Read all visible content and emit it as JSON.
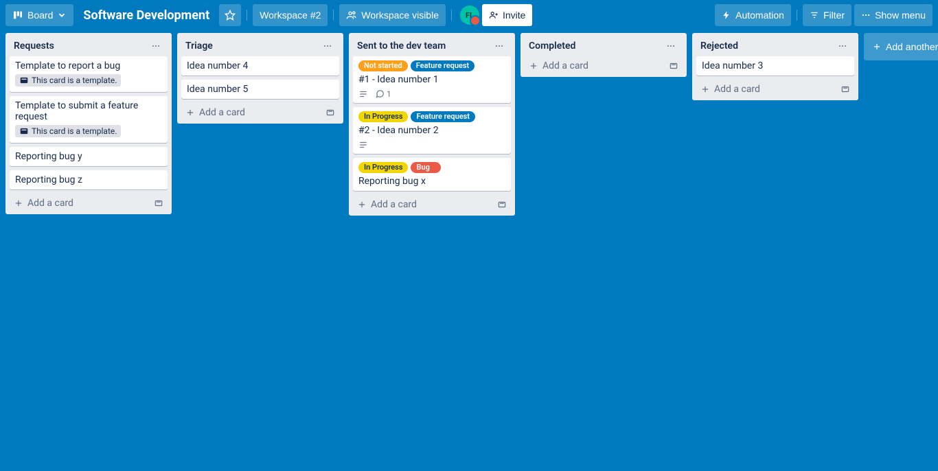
{
  "header": {
    "view_label": "Board",
    "board_title": "Software Development",
    "workspace_label": "Workspace #2",
    "visibility_label": "Workspace visible",
    "avatar_initials": "FL",
    "invite_label": "Invite",
    "automation_label": "Automation",
    "filter_label": "Filter",
    "show_menu_label": "Show menu"
  },
  "strings": {
    "add_card": "Add a card",
    "template_card": "This card is a template.",
    "add_another_list": "Add another list"
  },
  "lists": [
    {
      "title": "Requests",
      "cards": [
        {
          "title": "Template to report a bug",
          "is_template": true
        },
        {
          "title": "Template to submit a feature request",
          "is_template": true
        },
        {
          "title": "Reporting bug y"
        },
        {
          "title": "Reporting bug z"
        }
      ]
    },
    {
      "title": "Triage",
      "cards": [
        {
          "title": "Idea number 4"
        },
        {
          "title": "Idea number 5"
        }
      ]
    },
    {
      "title": "Sent to the dev team",
      "cards": [
        {
          "title": "#1 - Idea number 1",
          "labels": [
            {
              "text": "Not started",
              "color": "orange"
            },
            {
              "text": "Feature request",
              "color": "blue"
            }
          ],
          "has_description": true,
          "comments": 1
        },
        {
          "title": "#2 - Idea number 2",
          "labels": [
            {
              "text": "In Progress",
              "color": "yellow"
            },
            {
              "text": "Feature request",
              "color": "blue"
            }
          ],
          "has_description": true
        },
        {
          "title": "Reporting bug x",
          "labels": [
            {
              "text": "In Progress",
              "color": "yellow"
            },
            {
              "text": "Bug",
              "color": "red"
            }
          ]
        }
      ]
    },
    {
      "title": "Completed",
      "cards": []
    },
    {
      "title": "Rejected",
      "cards": [
        {
          "title": "Idea number 3"
        }
      ]
    }
  ]
}
